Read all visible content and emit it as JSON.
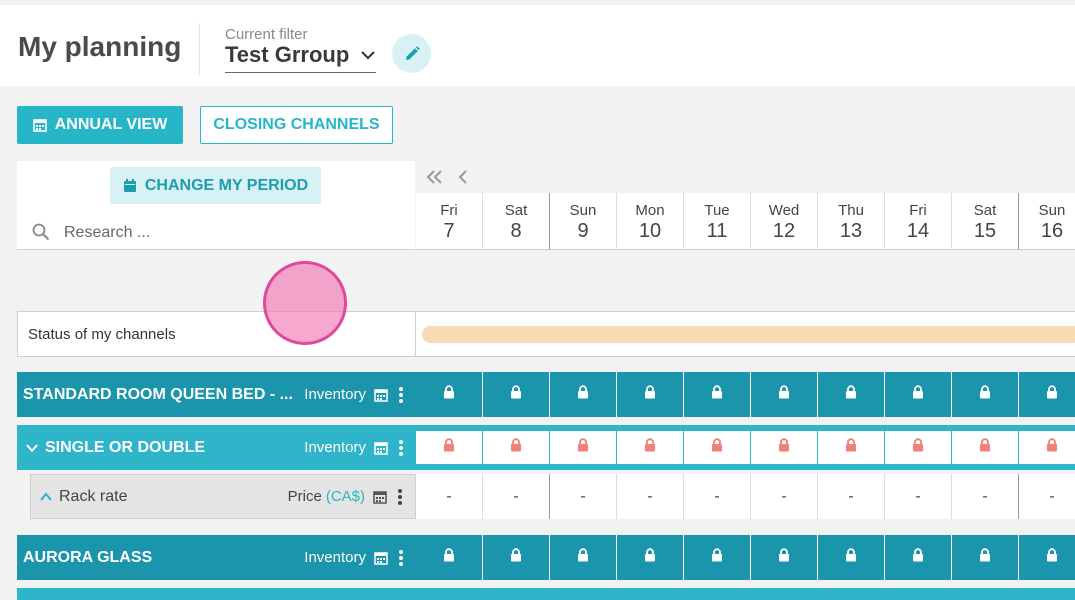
{
  "header": {
    "title": "My planning",
    "filter_label": "Current filter",
    "filter_value": "Test Grroup"
  },
  "toolbar": {
    "annual_view": "ANNUAL VIEW",
    "closing_channels": "CLOSING CHANNELS",
    "change_period": "CHANGE MY PERIOD"
  },
  "search": {
    "placeholder": "Research ..."
  },
  "days": [
    {
      "name": "Fri",
      "num": "7"
    },
    {
      "name": "Sat",
      "num": "8"
    },
    {
      "name": "Sun",
      "num": "9"
    },
    {
      "name": "Mon",
      "num": "10"
    },
    {
      "name": "Tue",
      "num": "11"
    },
    {
      "name": "Wed",
      "num": "12"
    },
    {
      "name": "Thu",
      "num": "13"
    },
    {
      "name": "Fri",
      "num": "14"
    },
    {
      "name": "Sat",
      "num": "15"
    },
    {
      "name": "Sun",
      "num": "16"
    }
  ],
  "status_row": {
    "label": "Status of my channels"
  },
  "rows": {
    "standard_room": {
      "name": "STANDARD ROOM QUEEN BED - ...",
      "kind": "Inventory"
    },
    "single_double": {
      "name": "SINGLE OR DOUBLE",
      "kind": "Inventory"
    },
    "rack_rate": {
      "name": "Rack rate",
      "kind": "Price",
      "currency": "(CA$)",
      "cell_value": "-"
    },
    "aurora_glass": {
      "name": "AURORA GLASS",
      "kind": "Inventory"
    }
  },
  "colors": {
    "accent": "#27b5c8",
    "row_dark": "#1b95ab",
    "row_light": "#2fb5ca",
    "closed_lock": "#f08079",
    "status_bar": "#f8dbb3",
    "touch_indicator": "#e0489a"
  },
  "icons": {
    "edit": "pencil-icon",
    "calendar": "calendar-icon",
    "search": "search-icon",
    "lock": "lock-icon",
    "menu": "kebab-menu-icon",
    "chevron": "chevron-icon"
  }
}
